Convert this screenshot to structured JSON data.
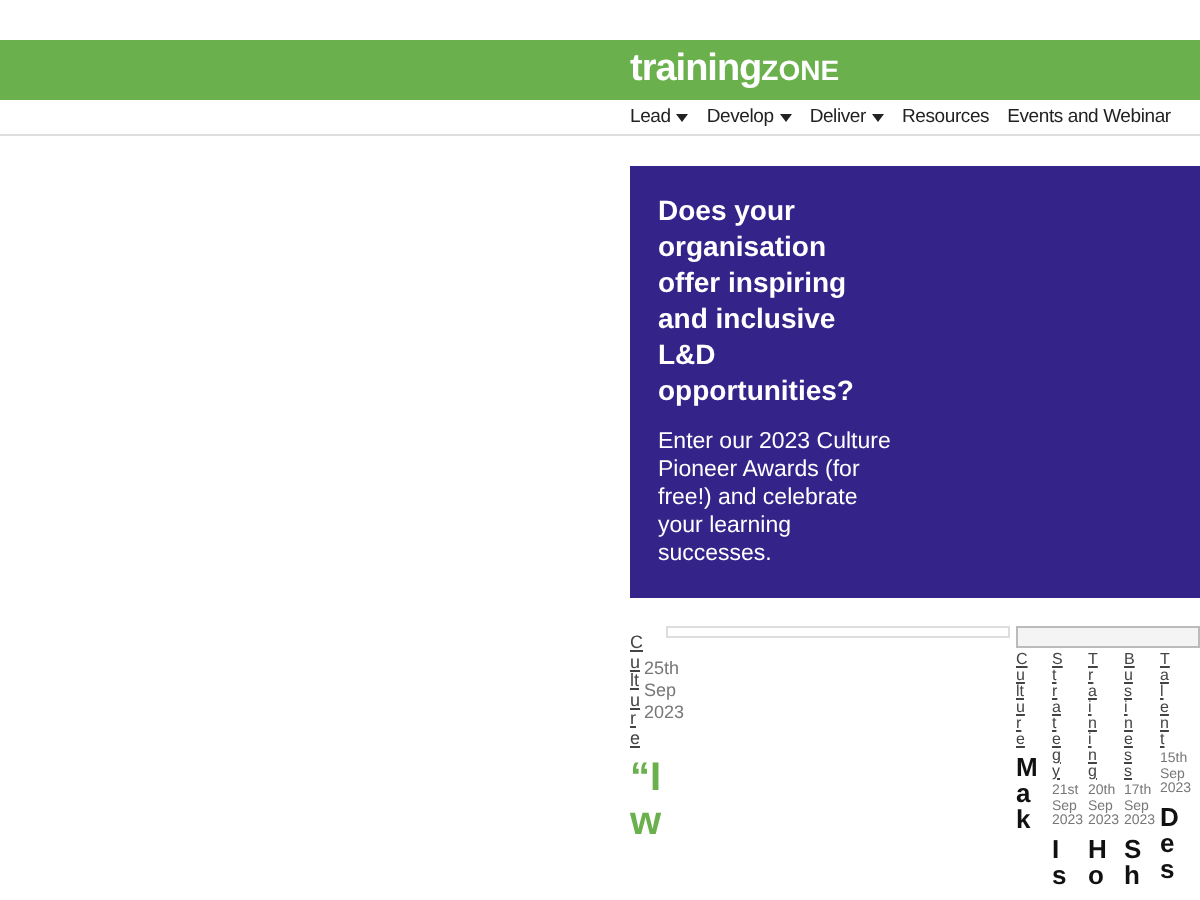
{
  "header": {
    "logo_main": "training",
    "logo_accent": "ZONE"
  },
  "nav": [
    {
      "label": "Lead",
      "has_menu": true
    },
    {
      "label": "Develop",
      "has_menu": true
    },
    {
      "label": "Deliver",
      "has_menu": true
    },
    {
      "label": "Resources",
      "has_menu": false
    },
    {
      "label": "Events and Webinar",
      "has_menu": false
    }
  ],
  "ad": {
    "heading": "Does your organisation offer inspiring and inclusive L&D opportunities?",
    "body": "Enter our 2023 Culture Pioneer Awards (for free!) and celebrate your learning successes."
  },
  "featured": {
    "category": "Culture",
    "date": "25th Sep 2023",
    "title": "“Iw"
  },
  "cards": [
    {
      "category": "Culture",
      "title": "Mak"
    },
    {
      "category": "Strategy",
      "date": "21st Sep 2023",
      "title": "Is"
    },
    {
      "category": "Training",
      "date": "20th Sep 2023",
      "title": "Ho"
    },
    {
      "category": "Business",
      "date": "17th Sep 2023",
      "title": "Sh"
    },
    {
      "category": "Talent",
      "date": "15th Sep 2023",
      "title": "Des"
    }
  ]
}
